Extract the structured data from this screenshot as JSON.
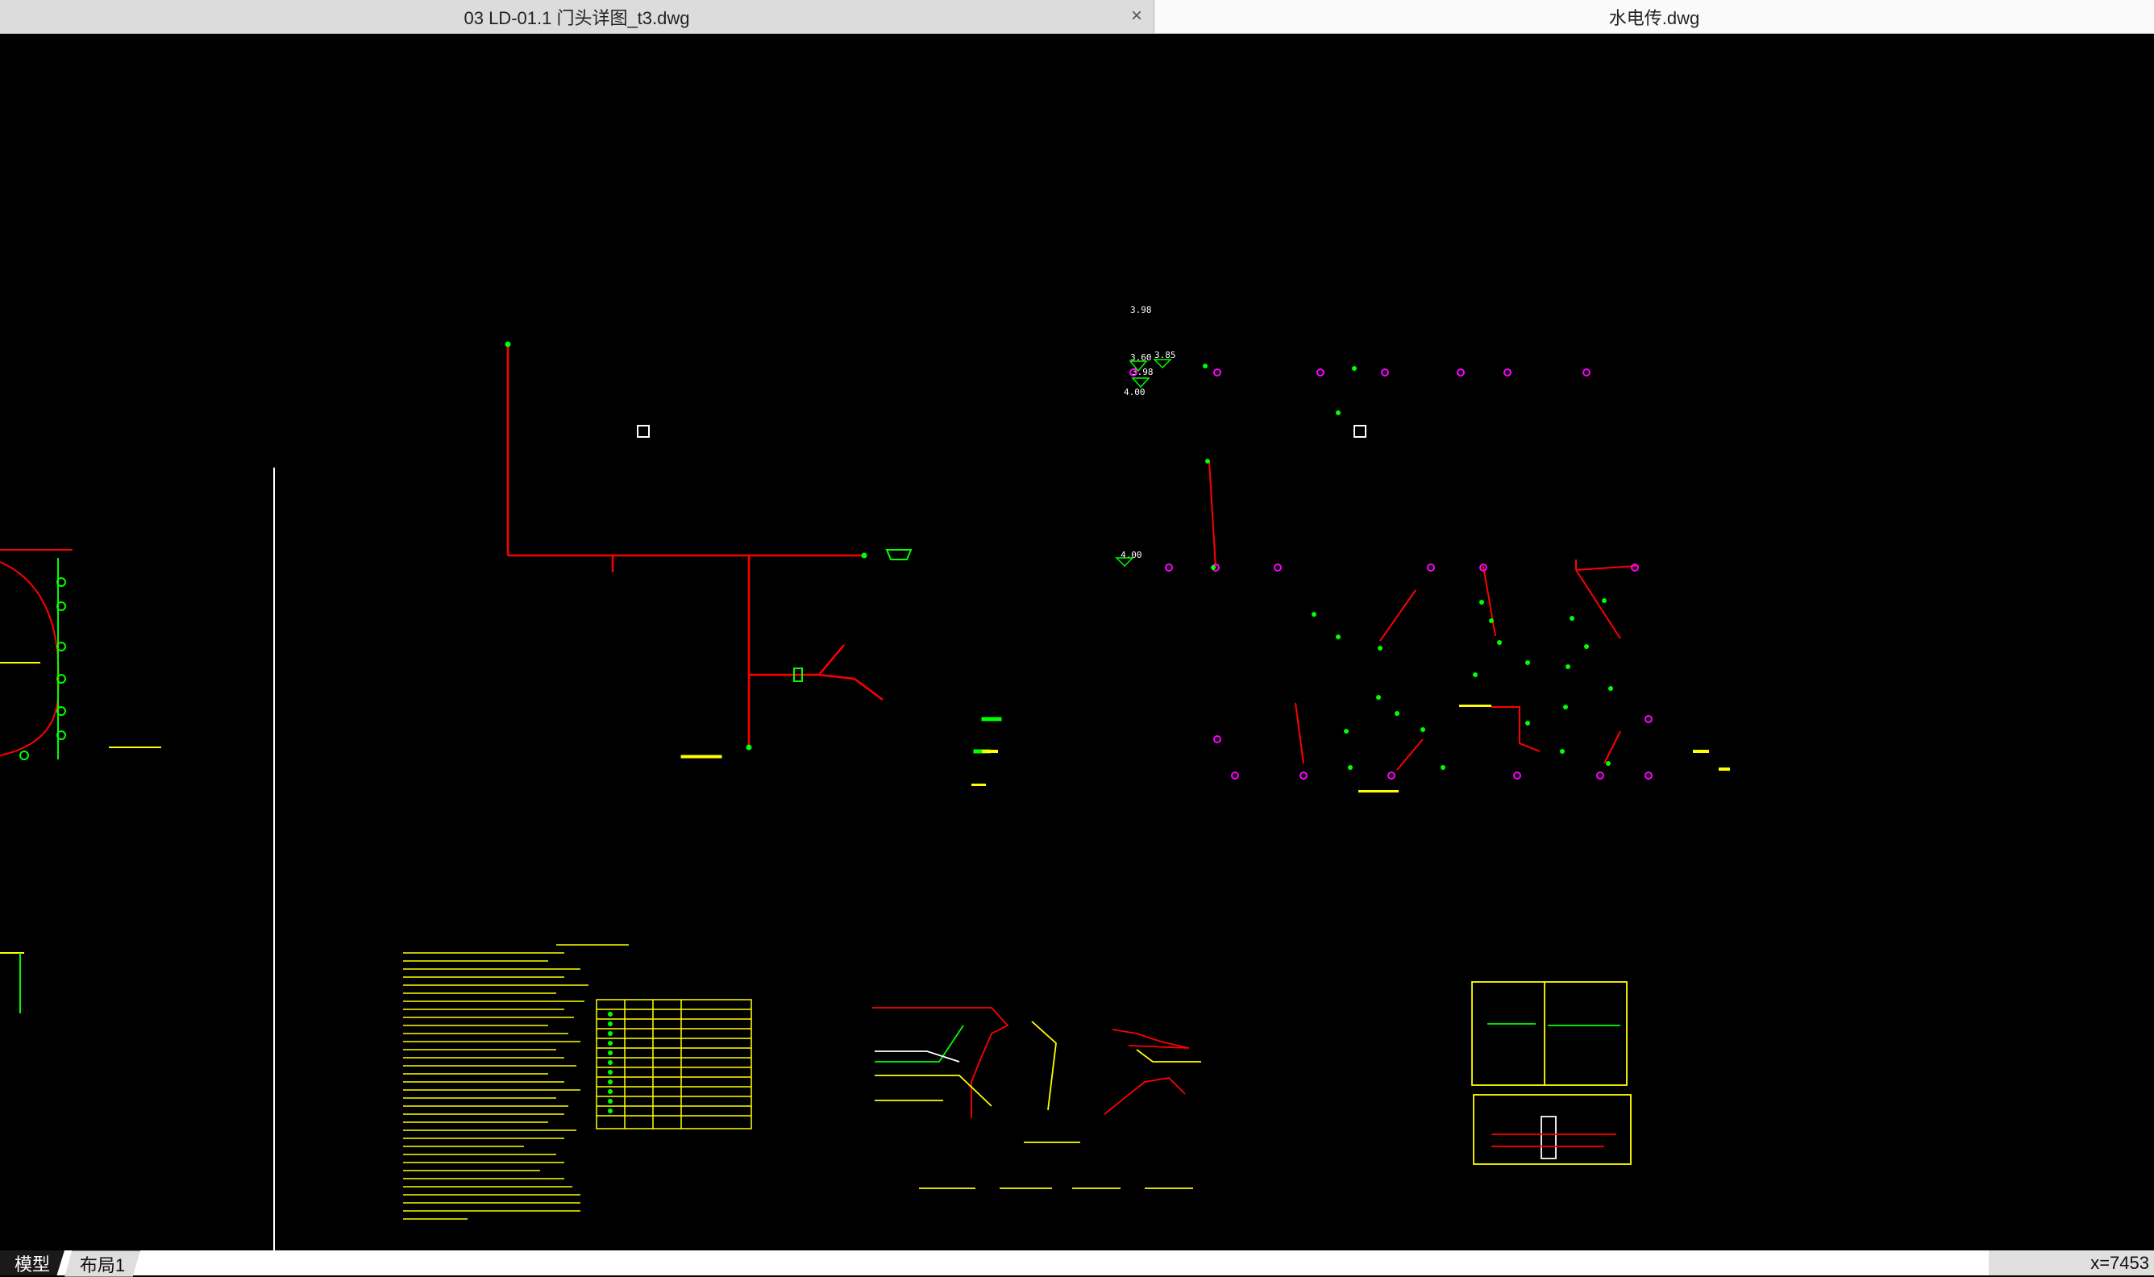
{
  "tabs": [
    {
      "label": "03 LD-01.1 门头详图_t3.dwg",
      "active": false
    },
    {
      "label": "水电传.dwg",
      "active": true
    }
  ],
  "tab_close_symbol": "×",
  "layout_tabs": [
    {
      "label": "模型",
      "active": true
    },
    {
      "label": "布局1",
      "active": false
    }
  ],
  "coordinate_readout": "x=7453",
  "elevation_labels": [
    "3.98",
    "3.60",
    "3.85",
    "3.98",
    "4.00",
    "4.00"
  ],
  "colors": {
    "background": "#000000",
    "pipe": "#ff0000",
    "fixture": "#00ff00",
    "annotation": "#ffff00",
    "node": "#ff00ff",
    "divider": "#ffffff"
  }
}
